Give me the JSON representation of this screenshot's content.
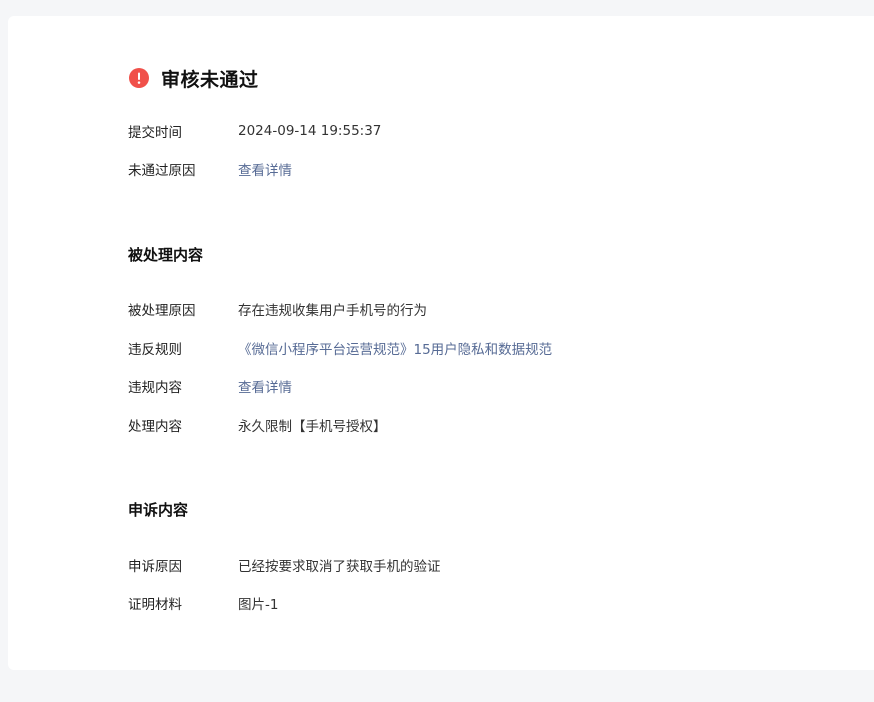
{
  "status": {
    "title": "审核未通过",
    "icon": "error-icon",
    "icon_color": "#f0504a"
  },
  "summary": {
    "submit_time_label": "提交时间",
    "submit_time_value": "2024-09-14 19:55:37",
    "reject_reason_label": "未通过原因",
    "reject_reason_link": "查看详情"
  },
  "handled": {
    "title": "被处理内容",
    "reason_label": "被处理原因",
    "reason_value": "存在违规收集用户手机号的行为",
    "rule_label": "违反规则",
    "rule_link": "《微信小程序平台运营规范》15用户隐私和数据规范",
    "content_label": "违规内容",
    "content_link": "查看详情",
    "action_label": "处理内容",
    "action_value": "永久限制【手机号授权】"
  },
  "appeal": {
    "title": "申诉内容",
    "reason_label": "申诉原因",
    "reason_value": "已经按要求取消了获取手机的验证",
    "proof_label": "证明材料",
    "proof_value": "图片-1"
  },
  "colors": {
    "link": "#576b95",
    "page_background": "#f5f6f8",
    "card_background": "#ffffff"
  }
}
